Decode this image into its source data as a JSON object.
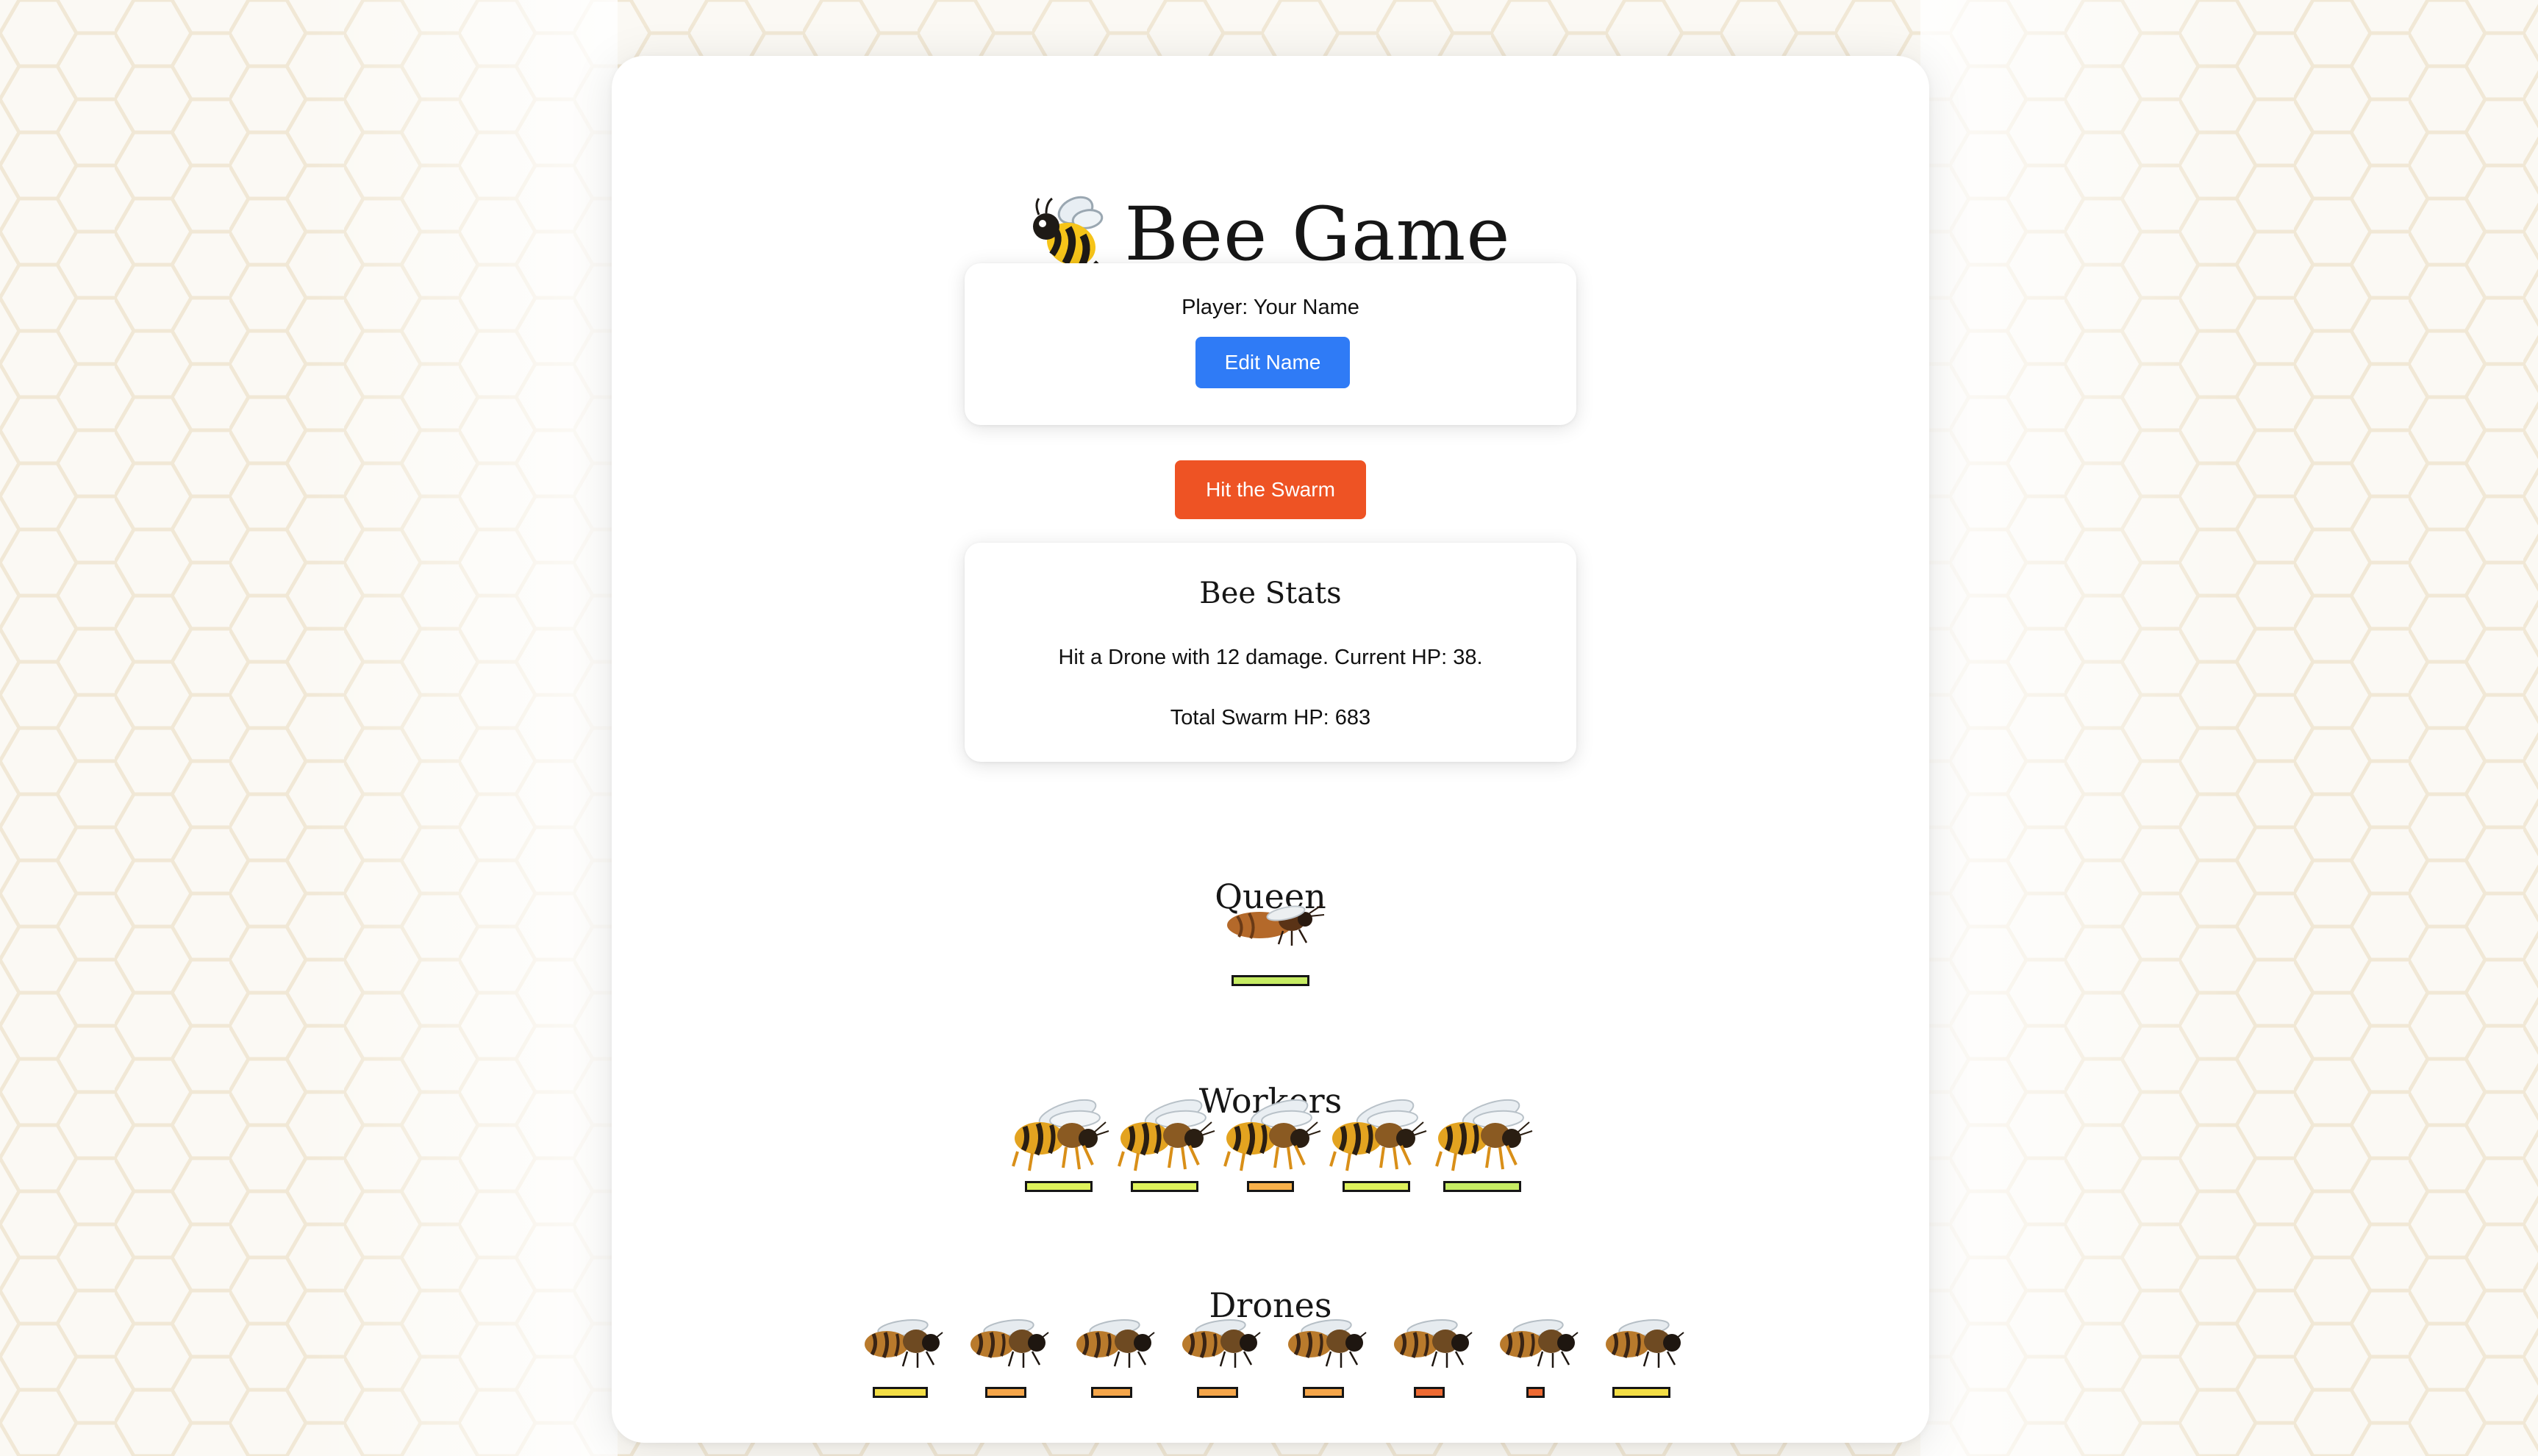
{
  "page": {
    "title": "Bee Game",
    "title_icon": "bee-emoji"
  },
  "player": {
    "label": "Player: Your Name",
    "edit_button": "Edit Name"
  },
  "actions": {
    "hit_button": "Hit the Swarm"
  },
  "stats": {
    "title": "Bee Stats",
    "last_hit": "Hit a Drone with 12 damage. Current HP: 38.",
    "total": "Total Swarm HP: 683"
  },
  "sections": {
    "queen": "Queen",
    "workers": "Workers",
    "drones": "Drones"
  },
  "colors": {
    "edit_button": "#2f7bf6",
    "hit_button": "#ee5324",
    "hp_high": "#c6ec63",
    "hp_mid_high": "#f3de45",
    "hp_mid": "#f7b04a",
    "hp_low": "#ee6a33"
  },
  "bees": {
    "queen": [
      {
        "hp_fraction": 1.0,
        "hp_color": "#c6ec63"
      }
    ],
    "workers": [
      {
        "hp_fraction": 0.86,
        "hp_color": "#def25b"
      },
      {
        "hp_fraction": 0.86,
        "hp_color": "#def25b"
      },
      {
        "hp_fraction": 0.58,
        "hp_color": "#f7b04a"
      },
      {
        "hp_fraction": 0.86,
        "hp_color": "#def25b"
      },
      {
        "hp_fraction": 1.0,
        "hp_color": "#c6ec63"
      }
    ],
    "drones": [
      {
        "hp_fraction": 0.72,
        "hp_color": "#f3de45"
      },
      {
        "hp_fraction": 0.52,
        "hp_color": "#f5a64a"
      },
      {
        "hp_fraction": 0.52,
        "hp_color": "#f5a64a"
      },
      {
        "hp_fraction": 0.52,
        "hp_color": "#f5a64a"
      },
      {
        "hp_fraction": 0.52,
        "hp_color": "#f5a64a"
      },
      {
        "hp_fraction": 0.38,
        "hp_color": "#ee6a33"
      },
      {
        "hp_fraction": 0.2,
        "hp_color": "#ee6a33"
      },
      {
        "hp_fraction": 0.76,
        "hp_color": "#f3de45"
      }
    ]
  }
}
